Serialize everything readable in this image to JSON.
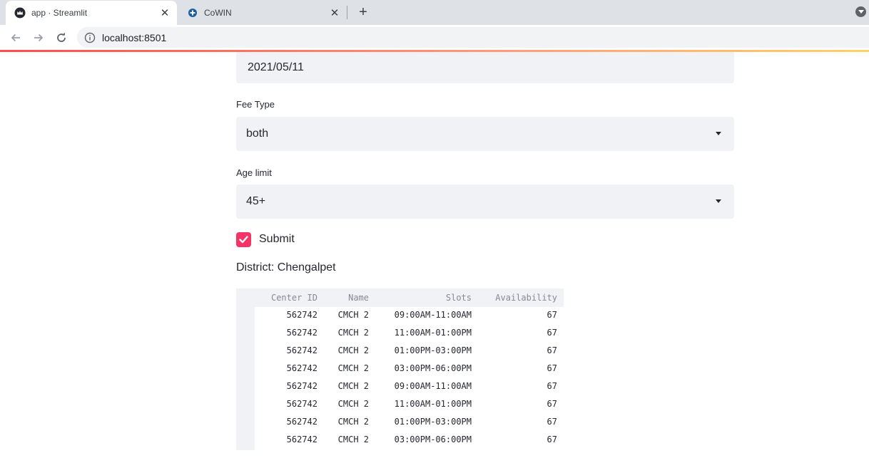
{
  "browser": {
    "tabs": [
      {
        "title": "app · Streamlit",
        "icon": "streamlit-crown-icon",
        "active": true
      },
      {
        "title": "CoWIN",
        "icon": "cowin-plus-icon",
        "active": false
      }
    ],
    "url": "localhost:8501"
  },
  "form": {
    "date_value": "2021/05/11",
    "fee_type": {
      "label": "Fee Type",
      "value": "both"
    },
    "age_limit": {
      "label": "Age limit",
      "value": "45+"
    },
    "submit": {
      "label": "Submit",
      "checked": true
    }
  },
  "district_text": "District: Chengalpet",
  "table": {
    "headers": [
      "Center ID",
      "Name",
      "Slots",
      "Availability"
    ],
    "rows": [
      [
        "562742",
        "CMCH 2",
        "09:00AM-11:00AM",
        "67"
      ],
      [
        "562742",
        "CMCH 2",
        "11:00AM-01:00PM",
        "67"
      ],
      [
        "562742",
        "CMCH 2",
        "01:00PM-03:00PM",
        "67"
      ],
      [
        "562742",
        "CMCH 2",
        "03:00PM-06:00PM",
        "67"
      ],
      [
        "562742",
        "CMCH 2",
        "09:00AM-11:00AM",
        "67"
      ],
      [
        "562742",
        "CMCH 2",
        "11:00AM-01:00PM",
        "67"
      ],
      [
        "562742",
        "CMCH 2",
        "01:00PM-03:00PM",
        "67"
      ],
      [
        "562742",
        "CMCH 2",
        "03:00PM-06:00PM",
        "67"
      ]
    ]
  },
  "colors": {
    "accent": "#f63366",
    "input_bg": "#f0f2f6",
    "text": "#262730"
  }
}
